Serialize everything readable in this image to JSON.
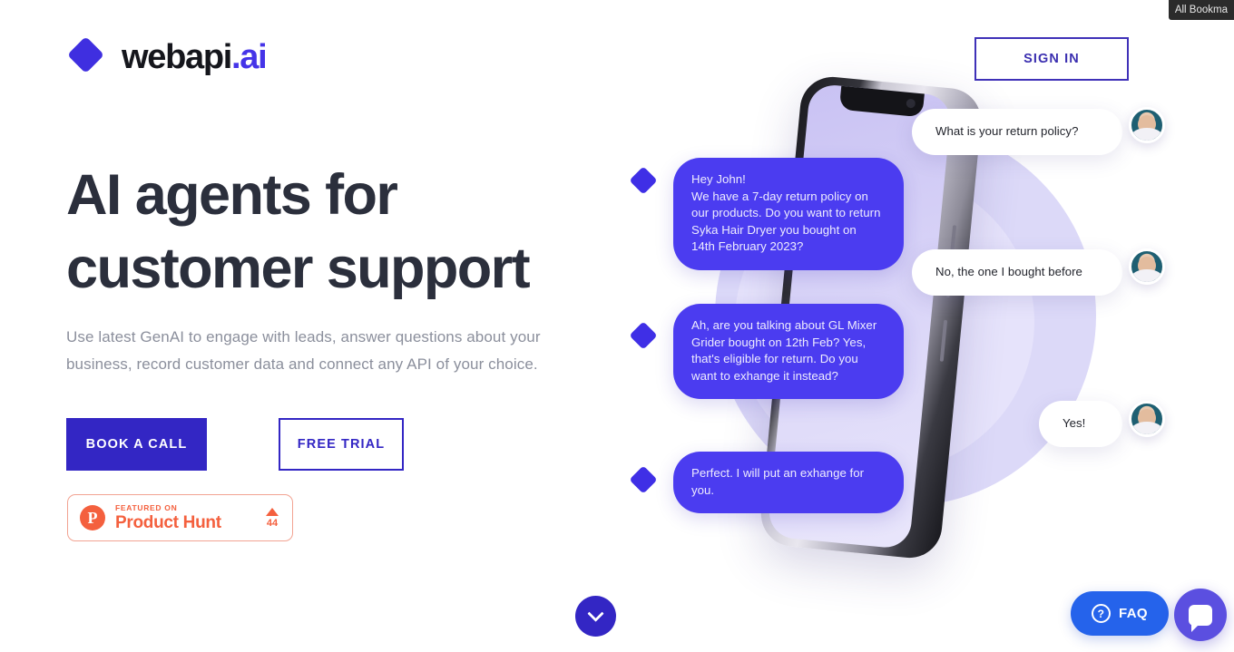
{
  "browser": {
    "bookmarks_tooltip": "All Bookma"
  },
  "header": {
    "logo_name": "webapi",
    "logo_suffix": ".ai",
    "sign_in_label": "SIGN IN"
  },
  "hero": {
    "headline_line1": "AI agents for",
    "headline_line2": "customer support",
    "subhead": "Use latest GenAI to engage with leads, answer questions about your business, record customer data and connect any API of your choice.",
    "cta_primary": "BOOK A CALL",
    "cta_secondary": "FREE TRIAL"
  },
  "product_hunt": {
    "logo_letter": "P",
    "featured_label": "FEATURED ON",
    "name": "Product Hunt",
    "upvotes": "44"
  },
  "conversation": [
    {
      "role": "user",
      "text": "What is your return policy?"
    },
    {
      "role": "bot",
      "text": "Hey John!\nWe have a 7-day return policy on our products. Do you want to return Syka Hair Dryer you bought on 14th February 2023?"
    },
    {
      "role": "user",
      "text": "No, the one I bought before"
    },
    {
      "role": "bot",
      "text": "Ah, are you talking about GL Mixer Grider bought on 12th Feb? Yes, that's eligible for return. Do you want to exhange it instead?"
    },
    {
      "role": "user",
      "text": "Yes!"
    },
    {
      "role": "bot",
      "text": "Perfect. I will put an exhange for you."
    }
  ],
  "widgets": {
    "faq_label": "FAQ",
    "faq_icon_glyph": "?",
    "scroll_hint": "scroll-down"
  },
  "colors": {
    "brand_indigo": "#3326c4",
    "bubble_blue": "#4b3cf0",
    "logo_accent": "#4534e8",
    "headline": "#2b2f3c",
    "subhead": "#8b8f9c",
    "product_hunt": "#f4603e",
    "faq_blue": "#2563eb",
    "chat_fab": "#5b4fe0",
    "blob_lavender": "#dcd9f8"
  }
}
